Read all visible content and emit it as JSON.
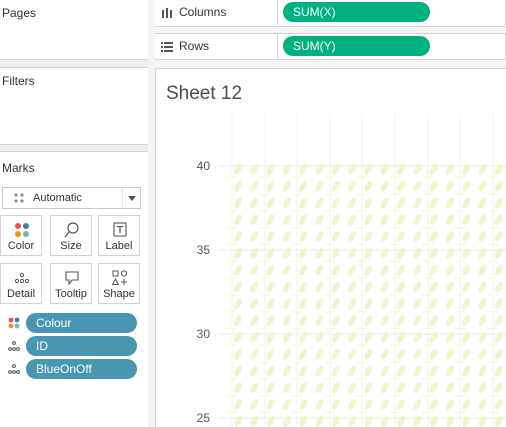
{
  "left_panel": {
    "pages_title": "Pages",
    "filters_title": "Filters",
    "marks_title": "Marks",
    "mark_type": "Automatic",
    "mark_buttons": [
      {
        "label": "Color",
        "icon": "color-dots-icon"
      },
      {
        "label": "Size",
        "icon": "size-lasso-icon"
      },
      {
        "label": "Label",
        "icon": "label-t-icon"
      },
      {
        "label": "Detail",
        "icon": "detail-dots-icon"
      },
      {
        "label": "Tooltip",
        "icon": "tooltip-bubble-icon"
      },
      {
        "label": "Shape",
        "icon": "shape-icon"
      }
    ],
    "mark_fields": [
      {
        "label": "Colour",
        "icon": "color-dots-icon"
      },
      {
        "label": "ID",
        "icon": "detail-dots-icon"
      },
      {
        "label": "BlueOnOff",
        "icon": "detail-dots-icon"
      }
    ]
  },
  "shelves": {
    "columns_label": "Columns",
    "columns_pill": "SUM(X)",
    "rows_label": "Rows",
    "rows_pill": "SUM(Y)"
  },
  "sheet": {
    "title": "Sheet 12"
  },
  "colors": {
    "pill_blue": "#4996b2",
    "pill_green": "#00b180",
    "mark_fill": "#eef6cf"
  },
  "chart_data": {
    "type": "scatter",
    "title": "",
    "xlabel": "",
    "ylabel": "",
    "y_ticks": [
      40,
      35,
      30,
      25
    ],
    "ylim": [
      23.5,
      43
    ],
    "grid": true,
    "legend": "none"
  }
}
